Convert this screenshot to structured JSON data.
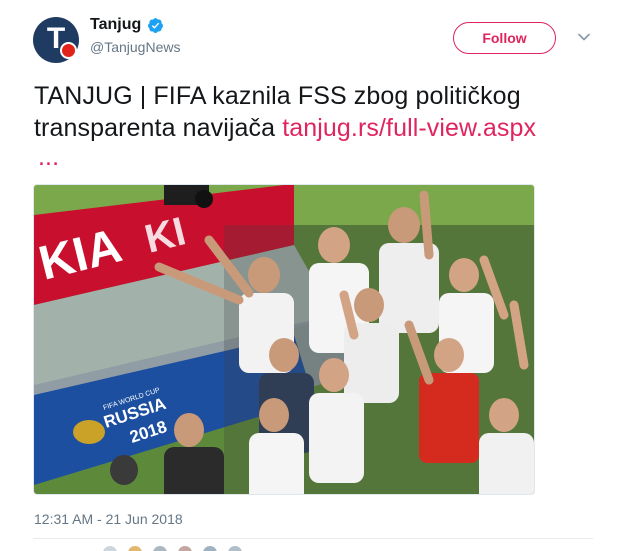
{
  "account": {
    "display_name": "Tanjug",
    "handle": "@TanjugNews",
    "avatar_letter": "T",
    "verified": true
  },
  "follow_button": {
    "label": "Follow"
  },
  "tweet": {
    "text": "TANJUG | FIFA kaznila FSS zbog političkog transparenta navijača ",
    "link": "tanjug.rs/full-view.aspx",
    "ellipsis": "...",
    "timestamp": "12:31 AM - 21 Jun 2018"
  },
  "photo": {
    "banner_text": "KIA",
    "board_line1": "FIFA WORLD CUP",
    "board_line2": "RUSSIA",
    "board_line3": "2018"
  },
  "colors": {
    "accent": "#e0245e",
    "verified_blue": "#1da1f2",
    "avatar_bg": "#1f3b62",
    "muted_text": "#657786"
  }
}
